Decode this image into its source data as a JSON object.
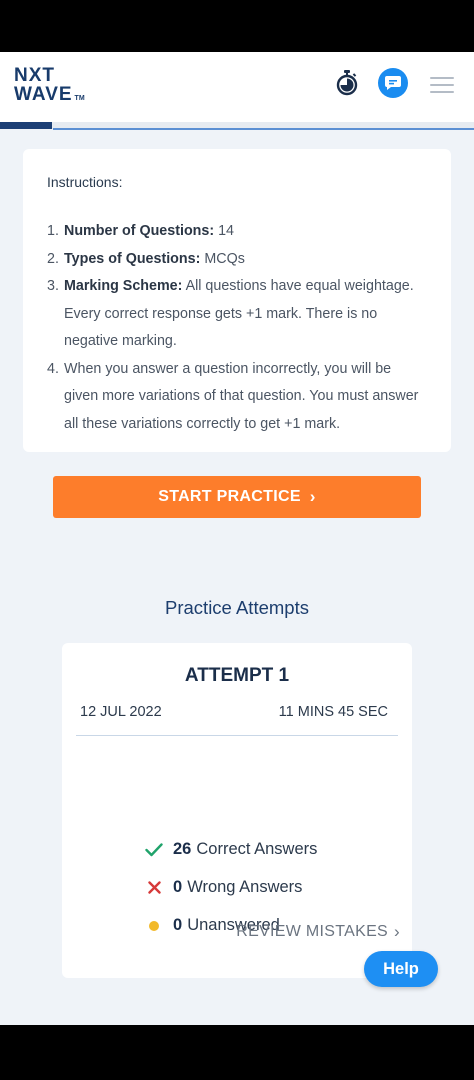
{
  "header": {
    "logo_line1": "NXT",
    "logo_line2": "WAVE",
    "logo_tm": "TM"
  },
  "progress": {
    "fraction": 0.11
  },
  "instructions": {
    "title": "Instructions:",
    "items": [
      {
        "num": "1.",
        "bold": "Number of Questions:",
        "text": " 14"
      },
      {
        "num": "2.",
        "bold": "Types of Questions:",
        "text": " MCQs"
      },
      {
        "num": "3.",
        "bold": "Marking Scheme:",
        "text": " All questions have equal weightage. Every correct response gets +1 mark. There is no negative marking."
      },
      {
        "num": "4.",
        "bold": "",
        "text": "When you answer a question incorrectly, you will be given more variations of that question. You must answer all these variations correctly to get +1 mark."
      }
    ]
  },
  "start_button": {
    "label": "START PRACTICE",
    "chevron": "›"
  },
  "attempts": {
    "heading": "Practice Attempts",
    "attempt": {
      "title": "ATTEMPT 1",
      "date": "12 JUL 2022",
      "duration": "11 MINS 45 SEC",
      "correct_count": "26",
      "correct_label": "Correct Answers",
      "wrong_count": "0",
      "wrong_label": "Wrong Answers",
      "unanswered_count": "0",
      "unanswered_label": "Unanswered",
      "review_label": "REVIEW MISTAKES",
      "review_chevron": "›"
    }
  },
  "help_button": {
    "label": "Help"
  },
  "icons": {
    "correct": "✓",
    "wrong": "✕"
  },
  "colors": {
    "accent_orange": "#fd7d2b",
    "brand_blue": "#1c3f75",
    "help_blue": "#1e8ff3",
    "correct_green": "#20a36b",
    "wrong_red": "#d63939",
    "unanswered_yellow": "#f2b92a"
  }
}
